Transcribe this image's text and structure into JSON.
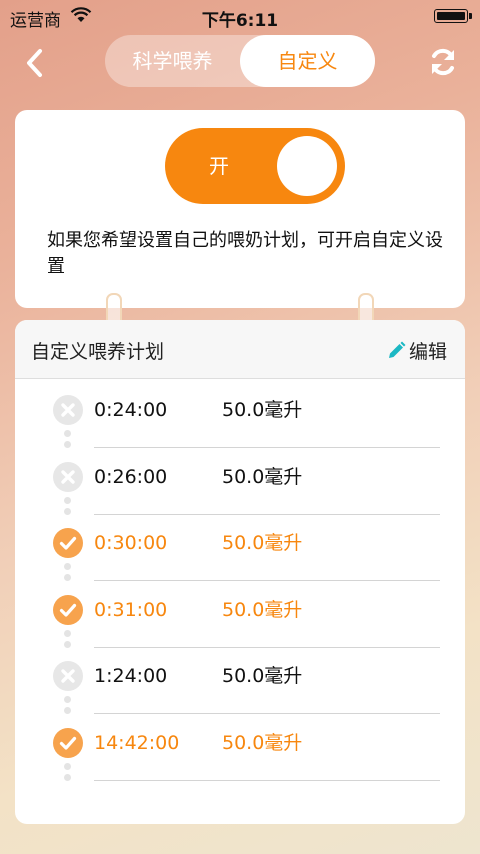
{
  "status_bar": {
    "carrier": "运营商",
    "time": "下午6:11"
  },
  "nav": {
    "tabs": [
      {
        "label": "科学喂养"
      },
      {
        "label": "自定义"
      }
    ],
    "active_tab": "自定义"
  },
  "switch": {
    "label": "开",
    "on": true
  },
  "description": "如果您希望设置自己的喂奶计划，可开启自定义设置",
  "plan": {
    "title": "自定义喂养计划",
    "edit_label": "编辑",
    "rows": [
      {
        "time": "0:24:00",
        "amount": "50.0毫升",
        "status": "missed"
      },
      {
        "time": "0:26:00",
        "amount": "50.0毫升",
        "status": "missed"
      },
      {
        "time": "0:30:00",
        "amount": "50.0毫升",
        "status": "done"
      },
      {
        "time": "0:31:00",
        "amount": "50.0毫升",
        "status": "done"
      },
      {
        "time": "1:24:00",
        "amount": "50.0毫升",
        "status": "missed"
      },
      {
        "time": "14:42:00",
        "amount": "50.0毫升",
        "status": "done"
      }
    ]
  },
  "colors": {
    "accent": "#f7870f",
    "done": "#f7a34d",
    "pending": "#e7e7e7",
    "edit_icon": "#1cb8c4"
  },
  "icons": {
    "back": "chevron-left-icon",
    "refresh": "refresh-icon",
    "edit": "pencil-icon",
    "done": "check-circle-icon",
    "missed": "x-circle-icon"
  }
}
